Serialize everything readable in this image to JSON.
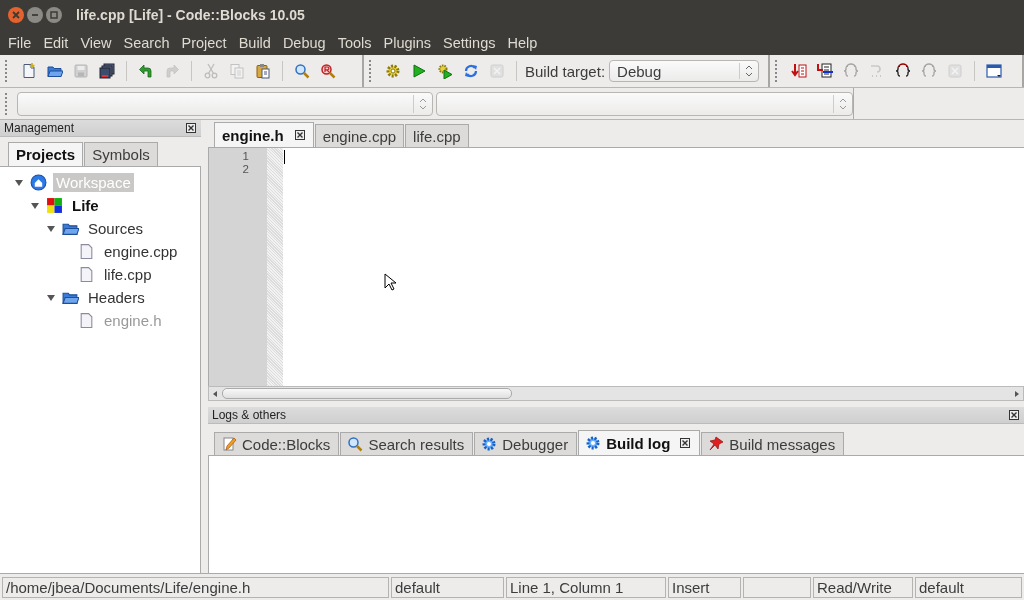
{
  "window": {
    "title": "life.cpp [Life] - Code::Blocks 10.05"
  },
  "menu": [
    "File",
    "Edit",
    "View",
    "Search",
    "Project",
    "Build",
    "Debug",
    "Tools",
    "Plugins",
    "Settings",
    "Help"
  ],
  "main_toolbar": [
    {
      "disabled": false
    },
    {
      "disabled": false
    },
    {
      "disabled": true
    },
    {
      "disabled": false
    },
    {
      "disabled": false
    },
    {
      "disabled": true
    },
    {
      "disabled": true
    },
    {
      "disabled": true
    },
    {
      "disabled": false
    },
    {
      "disabled": false
    },
    {
      "disabled": false
    }
  ],
  "compiler_toolbar": {
    "buttons": [
      {
        "disabled": false
      },
      {
        "disabled": false
      },
      {
        "disabled": false
      },
      {
        "disabled": false
      },
      {
        "disabled": true
      }
    ],
    "build_target_label": "Build target:",
    "build_target": "Debug"
  },
  "debugger_toolbar": [
    {
      "disabled": false
    },
    {
      "disabled": false
    },
    {
      "disabled": true
    },
    {
      "disabled": true
    },
    {
      "disabled": false
    },
    {
      "disabled": true
    },
    {
      "disabled": true
    },
    {
      "disabled": false
    }
  ],
  "management": {
    "title": "Management",
    "tabs": [
      {
        "label": "Projects",
        "selected": true
      },
      {
        "label": "Symbols",
        "selected": false
      }
    ],
    "tree": [
      {
        "label": "Workspace",
        "kind": "workspace",
        "expanded": true,
        "selected": true,
        "bold": false,
        "dimmed": false,
        "children": [
          {
            "label": "Life",
            "kind": "project",
            "expanded": true,
            "selected": false,
            "bold": true,
            "dimmed": false,
            "children": [
              {
                "label": "Sources",
                "kind": "folder",
                "expanded": true,
                "selected": false,
                "bold": false,
                "dimmed": false,
                "children": [
                  {
                    "label": "engine.cpp",
                    "kind": "file",
                    "selected": false,
                    "bold": false,
                    "dimmed": false
                  },
                  {
                    "label": "life.cpp",
                    "kind": "file",
                    "selected": false,
                    "bold": false,
                    "dimmed": false
                  }
                ]
              },
              {
                "label": "Headers",
                "kind": "folder",
                "expanded": true,
                "selected": false,
                "bold": false,
                "dimmed": false,
                "children": [
                  {
                    "label": "engine.h",
                    "kind": "file",
                    "selected": false,
                    "bold": false,
                    "dimmed": true
                  }
                ]
              }
            ]
          }
        ]
      }
    ]
  },
  "editor": {
    "tabs": [
      {
        "label": "engine.h",
        "selected": true
      },
      {
        "label": "engine.cpp",
        "selected": false
      },
      {
        "label": "life.cpp",
        "selected": false
      }
    ],
    "line_numbers": [
      "1",
      "2"
    ]
  },
  "logs": {
    "title": "Logs & others",
    "tabs": [
      {
        "label": "Code::Blocks",
        "selected": false
      },
      {
        "label": "Search results",
        "selected": false
      },
      {
        "label": "Debugger",
        "selected": false
      },
      {
        "label": "Build log",
        "selected": true
      },
      {
        "label": "Build messages",
        "selected": false
      }
    ]
  },
  "status_bar": [
    "/home/jbea/Documents/Life/engine.h",
    "default",
    "Line 1, Column 1",
    "Insert",
    "Read/Write",
    "default"
  ]
}
